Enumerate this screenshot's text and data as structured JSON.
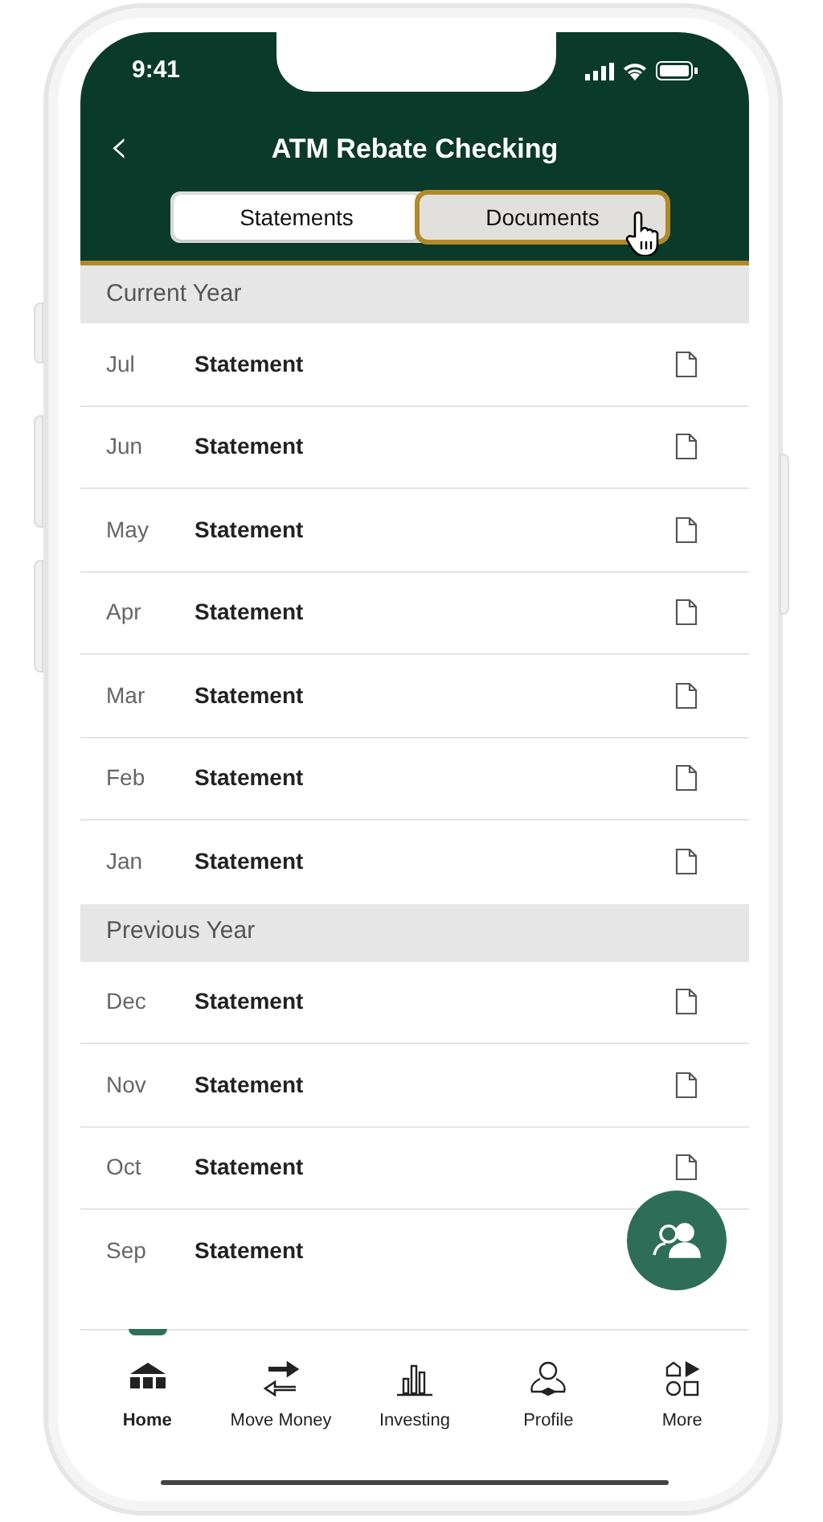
{
  "status_bar": {
    "time": "9:41"
  },
  "header": {
    "back": "‹",
    "title": "ATM Rebate Checking"
  },
  "tabs": [
    {
      "label": "Statements",
      "selected": true,
      "highlighted": false
    },
    {
      "label": "Documents",
      "selected": false,
      "highlighted": true
    }
  ],
  "sections": [
    {
      "title": "Current Year",
      "rows": [
        {
          "month": "Jul",
          "label": "Statement"
        },
        {
          "month": "Jun",
          "label": "Statement"
        },
        {
          "month": "May",
          "label": "Statement"
        },
        {
          "month": "Apr",
          "label": "Statement"
        },
        {
          "month": "Mar",
          "label": "Statement"
        },
        {
          "month": "Feb",
          "label": "Statement"
        },
        {
          "month": "Jan",
          "label": "Statement"
        }
      ]
    },
    {
      "title": "Previous Year",
      "rows": [
        {
          "month": "Dec",
          "label": "Statement"
        },
        {
          "month": "Nov",
          "label": "Statement"
        },
        {
          "month": "Oct",
          "label": "Statement"
        },
        {
          "month": "Sep",
          "label": "Statement",
          "icon_covered": true
        }
      ]
    }
  ],
  "nav": [
    {
      "kind": "home",
      "label": "Home",
      "selected": true
    },
    {
      "kind": "transfer",
      "label": "Move Money",
      "selected": false
    },
    {
      "kind": "chart",
      "label": "Investing",
      "selected": false
    },
    {
      "kind": "profile",
      "label": "Profile",
      "selected": false
    },
    {
      "kind": "more",
      "label": "More",
      "selected": false
    }
  ]
}
